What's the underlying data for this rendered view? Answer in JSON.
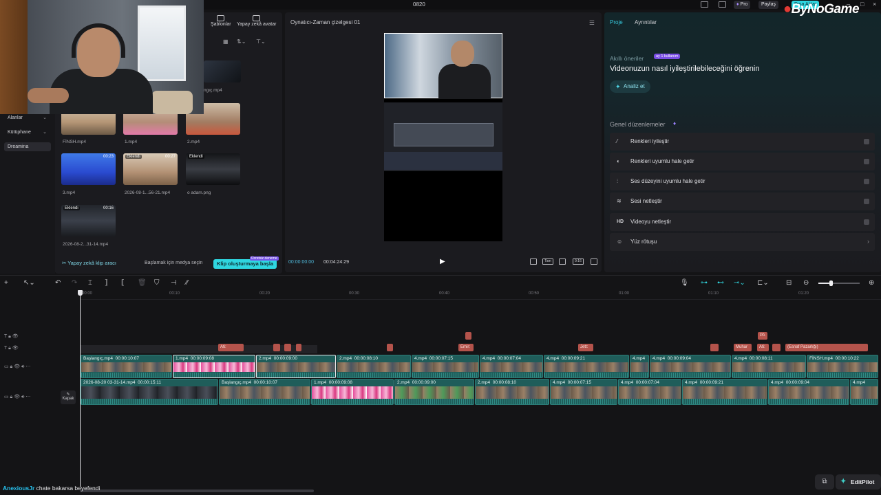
{
  "window": {
    "title": "0820",
    "pro_label": "Pro",
    "share_label": "Paylaş",
    "export_label": "Dışa Aktar"
  },
  "watermark": {
    "brand": "ByNoGame"
  },
  "left_nav": {
    "items": [
      {
        "label": "Alanlar",
        "chevron": true
      },
      {
        "label": "Kütüphane",
        "chevron": true
      },
      {
        "label": "Dreamina",
        "chevron": false
      }
    ]
  },
  "media": {
    "tabs": [
      {
        "label": "Şablonlar",
        "icon": "template-icon"
      },
      {
        "label": "Yapay zekâ avatar",
        "icon": "avatar-icon"
      }
    ],
    "items": [
      {
        "name": "ngıç.mp4",
        "duration": "",
        "badge": ""
      },
      {
        "name": "FİNSH.mp4",
        "duration": "",
        "badge": ""
      },
      {
        "name": "1.mp4",
        "duration": "",
        "badge": ""
      },
      {
        "name": "2.mp4",
        "duration": "",
        "badge": ""
      },
      {
        "name": "3.mp4",
        "duration": "00:23",
        "badge": ""
      },
      {
        "name": "2026-08-1...56-21.mp4",
        "duration": "00:27",
        "badge": "Eklendi"
      },
      {
        "name": "o adam.png",
        "duration": "",
        "badge": "Eklendi"
      },
      {
        "name": "2026-08-2...31-14.mp4",
        "duration": "00:16",
        "badge": "Eklendi"
      }
    ],
    "footer": {
      "ai_clip_label": "Yapay zekâ klip aracı",
      "hint": "Başlamak için medya seçin",
      "create_label": "Klip oluşturmaya başla",
      "promo": "Ücretsiz deneme"
    }
  },
  "player": {
    "title": "Oynatıcı-Zaman çizelgesi 01",
    "current_time": "00:00:00:00",
    "total_time": "00:04:24:29",
    "full_label": "Tam",
    "ratio_label": "9:16"
  },
  "right_panel": {
    "tabs": [
      {
        "label": "Proje",
        "active": true
      },
      {
        "label": "Ayrıntılar",
        "active": false
      }
    ],
    "ai_suggestions": {
      "subtitle": "Akıllı öneriler",
      "badge": "ay 1 kullanım",
      "heading": "Videonuzun nasıl iyileştirilebileceğini öğrenin",
      "analyze_label": "Analiz et"
    },
    "general_title": "Genel düzenlemeler",
    "options": [
      {
        "label": "Renkleri iyileştir",
        "icon": "magic-wand-icon",
        "kind": "toggle"
      },
      {
        "label": "Renkleri uyumlu hale getir",
        "icon": "palette-icon",
        "kind": "toggle"
      },
      {
        "label": "Ses düzeyini uyumlu hale getir",
        "icon": "volume-eq-icon",
        "kind": "toggle"
      },
      {
        "label": "Sesi netleştir",
        "icon": "audio-enhance-icon",
        "kind": "toggle"
      },
      {
        "label": "Videoyu netleştir",
        "icon": "hd-icon",
        "kind": "toggle"
      },
      {
        "label": "Yüz rötuşu",
        "icon": "face-retouch-icon",
        "kind": "chevron"
      }
    ]
  },
  "timeline": {
    "ruler": [
      "00:00",
      "00:10",
      "00:20",
      "00:30",
      "00:40",
      "00:50",
      "01:00",
      "01:10",
      "01:20"
    ],
    "markers": [
      {
        "label": "Ati:"
      },
      {
        "label": ""
      },
      {
        "label": ""
      },
      {
        "label": ""
      },
      {
        "label": ""
      },
      {
        "label": ""
      },
      {
        "label": "Emir:"
      },
      {
        "label": "Jett:"
      },
      {
        "label": ""
      },
      {
        "label": "PA"
      },
      {
        "label": "Muhar"
      },
      {
        "label": "Ati:"
      },
      {
        "label": ""
      },
      {
        "label": "(Esnaf Pazarlığı)"
      }
    ],
    "overlay_clips": [
      {
        "name": "Başlangıç.mp4",
        "time": "00:00:10:07"
      },
      {
        "name": "1.mp4",
        "time": "00:00:09:08"
      },
      {
        "name": "2.mp4",
        "time": "00:00:09:00"
      },
      {
        "name": "2.mp4",
        "time": "00:00:08:10"
      },
      {
        "name": "4.mp4",
        "time": "00:00:07:15"
      },
      {
        "name": "4.mp4",
        "time": "00:00:07:04"
      },
      {
        "name": "4.mp4",
        "time": "00:00:09:21"
      },
      {
        "name": "4.mp4",
        "time": ""
      },
      {
        "name": "4.mp4",
        "time": "00:00:09:04"
      },
      {
        "name": "4.mp4",
        "time": "00:00:08:11"
      },
      {
        "name": "FİNSH.mp4",
        "time": "00:00:10:22"
      }
    ],
    "main_clips": [
      {
        "name": "2026-08-20 03-31-14.mp4",
        "time": "00:00:15:11"
      },
      {
        "name": "Başlangıç.mp4",
        "time": "00:00:10:07"
      },
      {
        "name": "1.mp4",
        "time": "00:00:09:08"
      },
      {
        "name": "2.mp4",
        "time": "00:00:09:00"
      },
      {
        "name": "2.mp4",
        "time": "00:00:08:10"
      },
      {
        "name": "4.mp4",
        "time": "00:00:07:15"
      },
      {
        "name": "4.mp4",
        "time": "00:00:07:04"
      },
      {
        "name": "4.mp4",
        "time": "00:00:09:21"
      },
      {
        "name": "4.mp4",
        "time": "00:00:09:04"
      },
      {
        "name": "4.mp4",
        "time": ""
      }
    ],
    "cover_label": "Kapak"
  },
  "chat": {
    "user": "AnexiousJr",
    "message": "chate bakarsa beyefendi"
  },
  "editpilot": {
    "label": "EditPilot"
  }
}
